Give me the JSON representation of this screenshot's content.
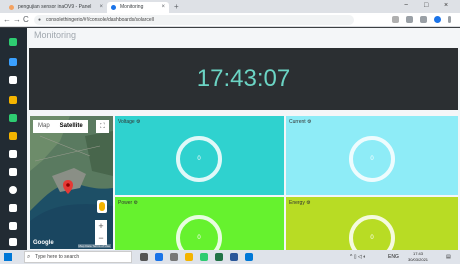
{
  "browser": {
    "tabs": [
      {
        "label": "pengujian sensor inaOV9 - Panel",
        "active": false
      },
      {
        "label": "Monitoring",
        "active": true
      }
    ],
    "new_tab": "+",
    "url": "consolethingerio/#!/console/dashboards/solarcell",
    "window_controls": {
      "minimize": "−",
      "maximize": "□",
      "close": "×"
    },
    "nav": {
      "back": "←",
      "forward": "→",
      "reload": "C"
    }
  },
  "page": {
    "title": "Monitoring",
    "clock": "17:43:07"
  },
  "map": {
    "map_label": "Map",
    "satellite_label": "Satellite",
    "google_label": "Google",
    "terms": "Map Data Terms of Use"
  },
  "cards": [
    {
      "title": "Voltage",
      "value": "0",
      "color": "#2fd2cf"
    },
    {
      "title": "Current",
      "value": "0",
      "color": "#8eecf7"
    },
    {
      "title": "Power",
      "value": "0",
      "color": "#66f22e"
    },
    {
      "title": "Energy",
      "value": "0",
      "color": "#b8dc24"
    }
  ],
  "taskbar": {
    "search_placeholder": "Type here to search",
    "language": "ENG",
    "time": "17:43",
    "date": "30/03/2021"
  },
  "colors": {
    "sidebar": "#222b33",
    "clock_bar": "#2b2f32",
    "clock_text": "#6bd4c4"
  }
}
